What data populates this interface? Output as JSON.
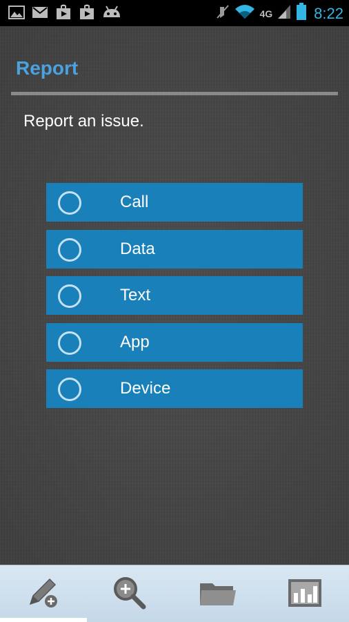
{
  "status_bar": {
    "time": "8:22",
    "network_label": "4G",
    "notification_icons": [
      "image-icon",
      "gmail-icon",
      "play-store-icon",
      "play-store-icon",
      "android-icon"
    ],
    "system_icons": [
      "mute-icon",
      "wifi-icon",
      "signal-icon",
      "battery-icon"
    ]
  },
  "page": {
    "title": "Report",
    "subtitle": "Report an issue."
  },
  "options": [
    {
      "label": "Call"
    },
    {
      "label": "Data"
    },
    {
      "label": "Text"
    },
    {
      "label": "App"
    },
    {
      "label": "Device"
    }
  ],
  "toolbar": {
    "items": [
      "report-icon",
      "search-icon",
      "folder-icon",
      "stats-icon"
    ],
    "selected_index": 0
  },
  "colors": {
    "accent": "#33b5e5",
    "title": "#4aa3df",
    "option_bg": "#1a80b9"
  }
}
